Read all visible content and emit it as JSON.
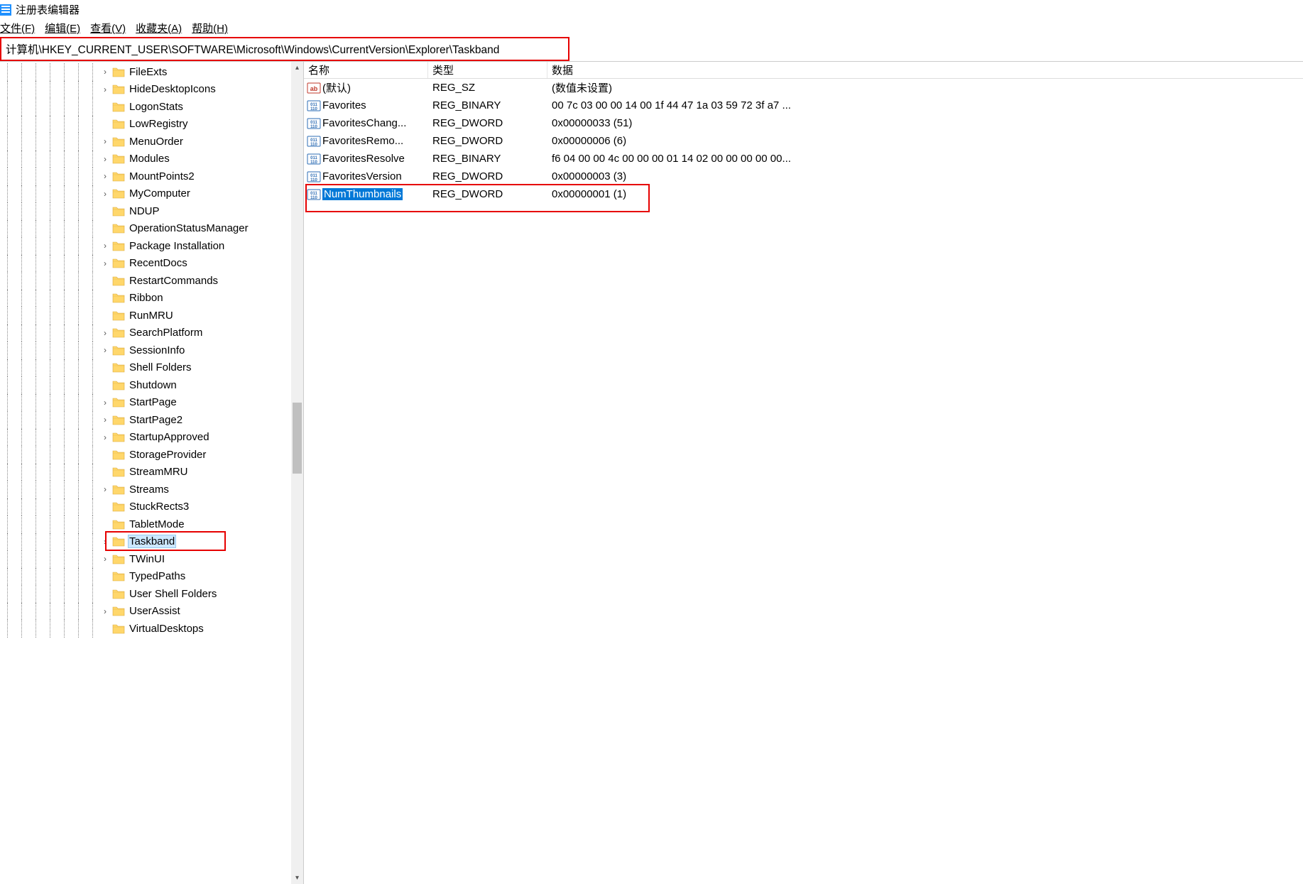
{
  "window": {
    "title": "注册表编辑器"
  },
  "menu": {
    "file": "文件(F)",
    "edit": "编辑(E)",
    "view": "查看(V)",
    "favorites": "收藏夹(A)",
    "help": "帮助(H)"
  },
  "address": "计算机\\HKEY_CURRENT_USER\\SOFTWARE\\Microsoft\\Windows\\CurrentVersion\\Explorer\\Taskband",
  "tree": [
    {
      "label": "FileExts",
      "expandable": true,
      "depth": 8
    },
    {
      "label": "HideDesktopIcons",
      "expandable": true,
      "depth": 8
    },
    {
      "label": "LogonStats",
      "expandable": false,
      "depth": 8
    },
    {
      "label": "LowRegistry",
      "expandable": false,
      "depth": 8
    },
    {
      "label": "MenuOrder",
      "expandable": true,
      "depth": 8
    },
    {
      "label": "Modules",
      "expandable": true,
      "depth": 8
    },
    {
      "label": "MountPoints2",
      "expandable": true,
      "depth": 8
    },
    {
      "label": "MyComputer",
      "expandable": true,
      "depth": 8
    },
    {
      "label": "NDUP",
      "expandable": false,
      "depth": 8
    },
    {
      "label": "OperationStatusManager",
      "expandable": false,
      "depth": 8
    },
    {
      "label": "Package Installation",
      "expandable": true,
      "depth": 8
    },
    {
      "label": "RecentDocs",
      "expandable": true,
      "depth": 8
    },
    {
      "label": "RestartCommands",
      "expandable": false,
      "depth": 8
    },
    {
      "label": "Ribbon",
      "expandable": false,
      "depth": 8
    },
    {
      "label": "RunMRU",
      "expandable": false,
      "depth": 8
    },
    {
      "label": "SearchPlatform",
      "expandable": true,
      "depth": 8
    },
    {
      "label": "SessionInfo",
      "expandable": true,
      "depth": 8
    },
    {
      "label": "Shell Folders",
      "expandable": false,
      "depth": 8
    },
    {
      "label": "Shutdown",
      "expandable": false,
      "depth": 8
    },
    {
      "label": "StartPage",
      "expandable": true,
      "depth": 8
    },
    {
      "label": "StartPage2",
      "expandable": true,
      "depth": 8
    },
    {
      "label": "StartupApproved",
      "expandable": true,
      "depth": 8
    },
    {
      "label": "StorageProvider",
      "expandable": false,
      "depth": 8
    },
    {
      "label": "StreamMRU",
      "expandable": false,
      "depth": 8
    },
    {
      "label": "Streams",
      "expandable": true,
      "depth": 8
    },
    {
      "label": "StuckRects3",
      "expandable": false,
      "depth": 8
    },
    {
      "label": "TabletMode",
      "expandable": false,
      "depth": 8
    },
    {
      "label": "Taskband",
      "expandable": true,
      "depth": 8,
      "selected": true
    },
    {
      "label": "TWinUI",
      "expandable": true,
      "depth": 8
    },
    {
      "label": "TypedPaths",
      "expandable": false,
      "depth": 8
    },
    {
      "label": "User Shell Folders",
      "expandable": false,
      "depth": 8
    },
    {
      "label": "UserAssist",
      "expandable": true,
      "depth": 8
    },
    {
      "label": "VirtualDesktops",
      "expandable": false,
      "depth": 8
    }
  ],
  "columns": {
    "name": "名称",
    "type": "类型",
    "data": "数据"
  },
  "values": [
    {
      "icon": "string",
      "name": "(默认)",
      "type": "REG_SZ",
      "data": "(数值未设置)"
    },
    {
      "icon": "binary",
      "name": "Favorites",
      "type": "REG_BINARY",
      "data": "00 7c 03 00 00 14 00 1f 44 47 1a 03 59 72 3f a7 ..."
    },
    {
      "icon": "binary",
      "name": "FavoritesChang...",
      "type": "REG_DWORD",
      "data": "0x00000033 (51)"
    },
    {
      "icon": "binary",
      "name": "FavoritesRemo...",
      "type": "REG_DWORD",
      "data": "0x00000006 (6)"
    },
    {
      "icon": "binary",
      "name": "FavoritesResolve",
      "type": "REG_BINARY",
      "data": "f6 04 00 00 4c 00 00 00 01 14 02 00 00 00 00 00..."
    },
    {
      "icon": "binary",
      "name": "FavoritesVersion",
      "type": "REG_DWORD",
      "data": "0x00000003 (3)"
    },
    {
      "icon": "binary",
      "name": "NumThumbnails",
      "type": "REG_DWORD",
      "data": "0x00000001 (1)",
      "selected": true
    }
  ]
}
